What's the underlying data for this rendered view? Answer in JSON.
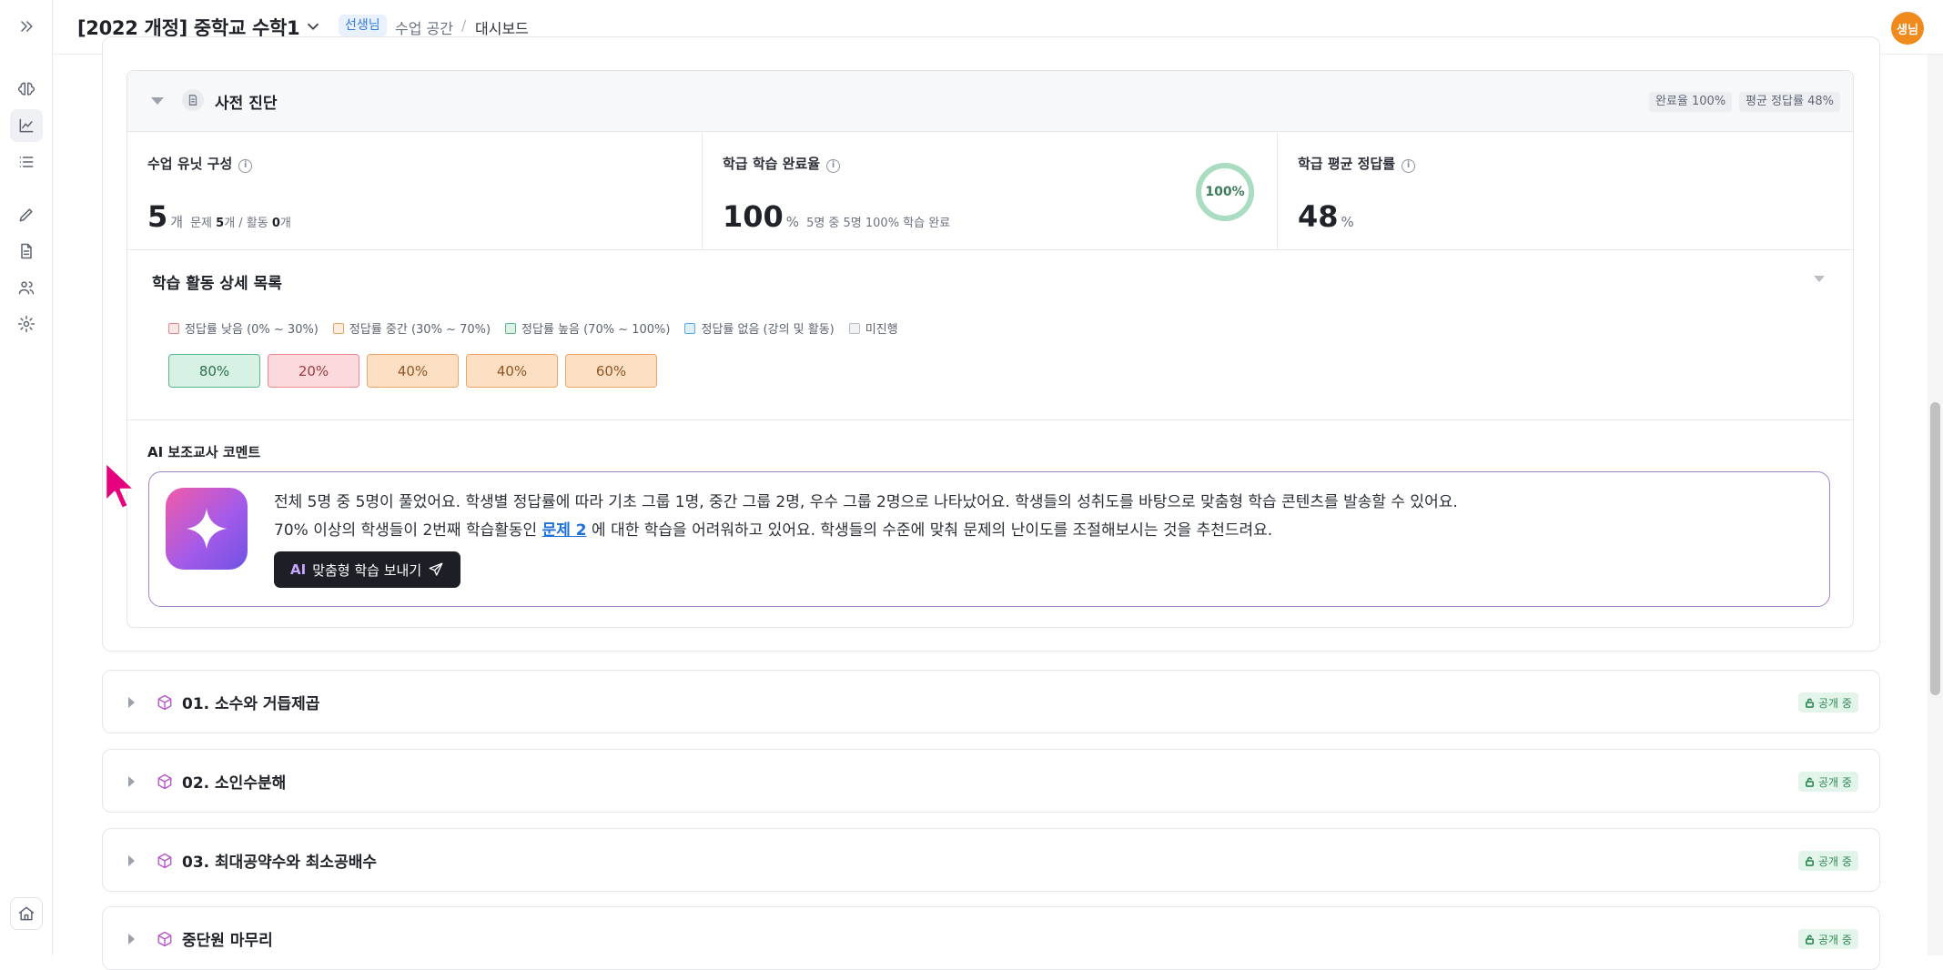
{
  "header": {
    "course_title": "[2022 개정] 중학교 수학1",
    "role_badge": "선생님",
    "breadcrumb": [
      "수업 공간",
      "/",
      "대시보드"
    ],
    "avatar_text": "생님"
  },
  "sidebar": {
    "items": [
      {
        "icon": "chevrons-right-icon"
      },
      {
        "icon": "brain-icon"
      },
      {
        "icon": "chart-line-icon",
        "active": true
      },
      {
        "icon": "list-icon"
      },
      {
        "icon": "pencil-icon"
      },
      {
        "icon": "document-icon"
      },
      {
        "icon": "users-icon"
      },
      {
        "icon": "gear-icon"
      },
      {
        "icon": "home-icon"
      }
    ]
  },
  "diagnosis": {
    "title": "사전 진단",
    "completion_pill": "완료율 100%",
    "avg_pill": "평균 정답률 48%",
    "stats": [
      {
        "label": "수업 유닛 구성",
        "value": "5",
        "unit": "개",
        "detail_prefix": "문제",
        "detail_count1": "5",
        "detail_mid": "개 / 활동",
        "detail_count2": "0",
        "detail_suffix": "개"
      },
      {
        "label": "학급 학습 완료율",
        "value": "100",
        "unit": "%",
        "detail": "5명 중 5명 100% 학습 완료",
        "ring_text": "100%",
        "ring_value": 1.0
      },
      {
        "label": "학급 평균 정답률",
        "value": "48",
        "unit": "%"
      }
    ],
    "activity_title": "학습 활동 상세 목록",
    "legend": [
      {
        "text": "정답률 낮음 (0% ~ 30%)",
        "color": "#e8858c"
      },
      {
        "text": "정답률 중간 (30% ~ 70%)",
        "color": "#eca465"
      },
      {
        "text": "정답률 높음 (70% ~ 100%)",
        "color": "#59b98b"
      },
      {
        "text": "정답률 없음 (강의 및 활동)",
        "color": "#5aa9e6"
      },
      {
        "text": "미진행",
        "color": "#b8bdc6"
      }
    ],
    "chips": [
      {
        "text": "80%",
        "level": "high"
      },
      {
        "text": "20%",
        "level": "low"
      },
      {
        "text": "40%",
        "level": "mid"
      },
      {
        "text": "40%",
        "level": "mid"
      },
      {
        "text": "60%",
        "level": "mid"
      }
    ],
    "ai": {
      "label": "AI 보조교사 코멘트",
      "line1": "전체 5명 중 5명이 풀었어요. 학생별 정답률에 따라 기초 그룹 1명, 중간 그룹 2명, 우수 그룹 2명으로 나타났어요. 학생들의 성취도를 바탕으로 맞춤형 학습 콘텐츠를 발송할 수 있어요.",
      "line2_pre": "70% 이상의 학생들이 2번째 학습활동인 ",
      "line2_link": "문제 2",
      "line2_post": " 에 대한 학습을 어려워하고 있어요. 학생들의 수준에 맞춰 문제의 난이도를 조절해보시는 것을 추천드려요.",
      "button_ai": "AI",
      "button_text": "맞춤형 학습 보내기"
    }
  },
  "units": [
    {
      "title": "01. 소수와 거듭제곱",
      "status": "공개 중"
    },
    {
      "title": "02. 소인수분해",
      "status": "공개 중"
    },
    {
      "title": "03. 최대공약수와 최소공배수",
      "status": "공개 중"
    },
    {
      "title": "중단원 마무리",
      "status": "공개 중"
    }
  ]
}
